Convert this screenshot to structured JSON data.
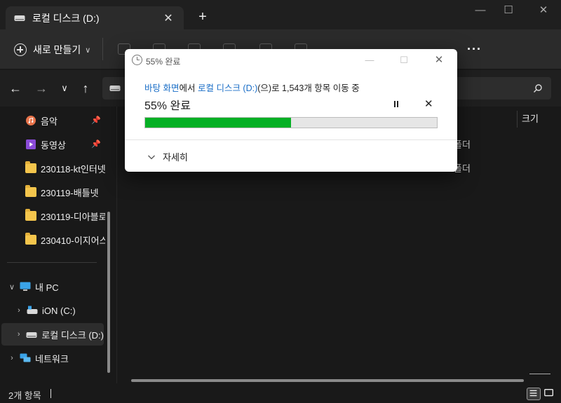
{
  "window": {
    "tab_title": "로컬 디스크 (D:)",
    "tab_close": "✕",
    "new_tab": "+",
    "minimize": "—",
    "maximize": "☐",
    "close": "✕"
  },
  "toolbar": {
    "new_label": "새로 만들기",
    "new_caret": "∨",
    "more": "···"
  },
  "nav": {
    "back": "←",
    "forward": "→",
    "recent": "∨",
    "up": "↑"
  },
  "sidebar": {
    "items": [
      {
        "label": "음악",
        "icon": "music-icon",
        "pinned": true
      },
      {
        "label": "동영상",
        "icon": "video-icon",
        "pinned": true
      },
      {
        "label": "230118-kt인터넷",
        "icon": "folder-icon"
      },
      {
        "label": "230119-배틀넷",
        "icon": "folder-icon"
      },
      {
        "label": "230119-디아블로",
        "icon": "folder-icon"
      },
      {
        "label": "230410-이지어스",
        "icon": "folder-icon"
      }
    ],
    "tree": [
      {
        "label": "내 PC",
        "icon": "pc-icon",
        "expanded": true
      },
      {
        "label": "iON (C:)",
        "icon": "system-drive-icon"
      },
      {
        "label": "로컬 디스크 (D:)",
        "icon": "drive-icon",
        "selected": true
      },
      {
        "label": "네트워크",
        "icon": "network-icon"
      }
    ],
    "pin_glyph": "📌"
  },
  "content": {
    "column_size": "크기",
    "rows": [
      "폴더",
      "폴더"
    ]
  },
  "status": {
    "item_count": "2개 항목"
  },
  "dialog": {
    "title": "55% 완료",
    "desc_source": "바탕 화면",
    "desc_mid": "에서 ",
    "desc_dest": "로컬 디스크 (D:)",
    "desc_tail": "(으)로 1,543개 항목 이동 중",
    "percent_label": "55% 완료",
    "progress_fraction": 0.5,
    "stop": "✕",
    "details_label": "자세히",
    "accent": "#06b025",
    "link_color": "#1a6ec7"
  }
}
